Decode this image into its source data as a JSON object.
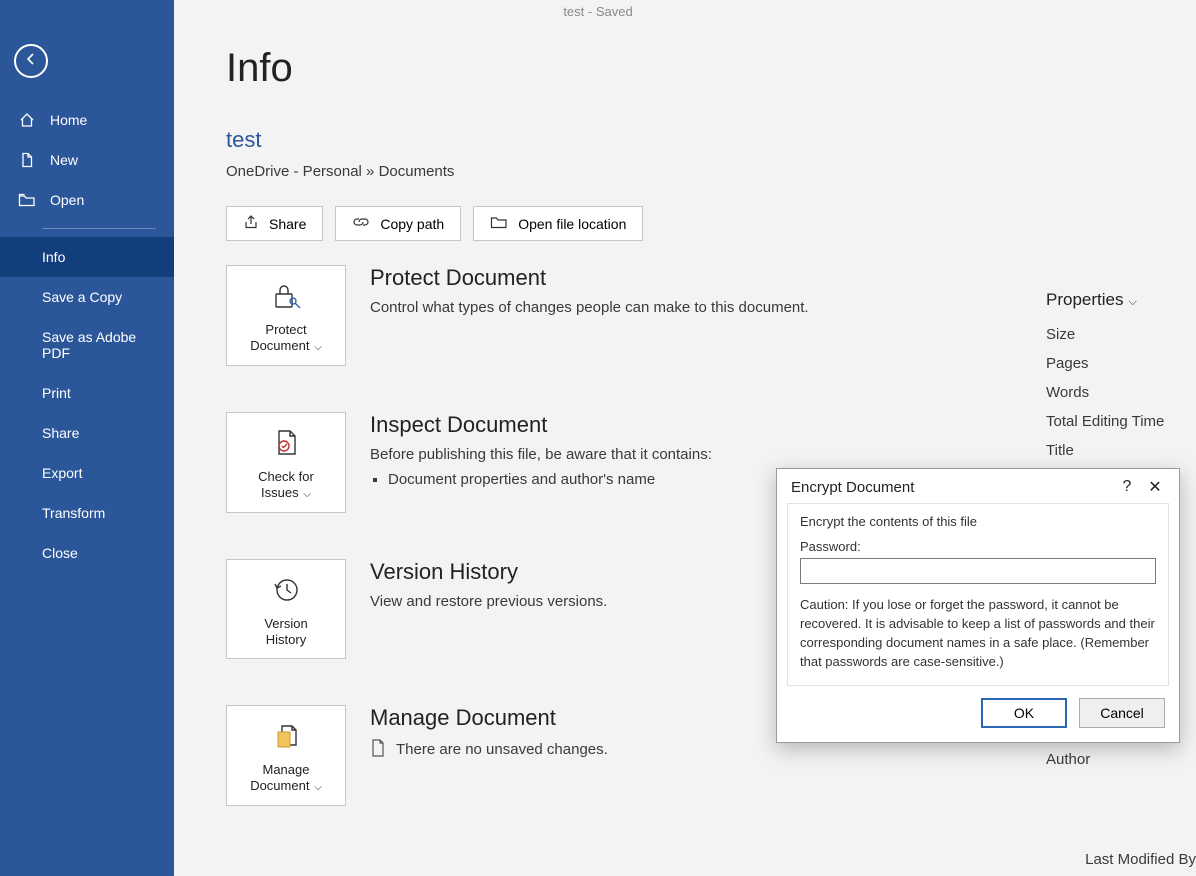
{
  "titlebar": {
    "text": "test - Saved"
  },
  "sidebar": {
    "back_aria": "Back",
    "items_top": [
      {
        "id": "home",
        "label": "Home"
      },
      {
        "id": "new",
        "label": "New"
      },
      {
        "id": "open",
        "label": "Open"
      }
    ],
    "items_bottom": [
      {
        "id": "info",
        "label": "Info",
        "active": true
      },
      {
        "id": "savecopy",
        "label": "Save a Copy"
      },
      {
        "id": "saveadobe",
        "label": "Save as Adobe PDF"
      },
      {
        "id": "print",
        "label": "Print"
      },
      {
        "id": "share",
        "label": "Share"
      },
      {
        "id": "export",
        "label": "Export"
      },
      {
        "id": "transform",
        "label": "Transform"
      },
      {
        "id": "close",
        "label": "Close"
      }
    ]
  },
  "main": {
    "page_title": "Info",
    "doc_name": "test",
    "breadcrumb": "OneDrive - Personal » Documents",
    "actions": {
      "share": "Share",
      "copy_path": "Copy path",
      "open_location": "Open file location"
    },
    "sections": {
      "protect": {
        "tile_line1": "Protect",
        "tile_line2": "Document",
        "title": "Protect Document",
        "desc": "Control what types of changes people can make to this document."
      },
      "inspect": {
        "tile_line1": "Check for",
        "tile_line2": "Issues",
        "title": "Inspect Document",
        "desc": "Before publishing this file, be aware that it contains:",
        "bullet1": "Document properties and author's name"
      },
      "version": {
        "tile_line1": "Version",
        "tile_line2": "History",
        "title": "Version History",
        "desc": "View and restore previous versions."
      },
      "manage": {
        "tile_line1": "Manage",
        "tile_line2": "Document",
        "title": "Manage Document",
        "desc": "There are no unsaved changes."
      }
    }
  },
  "properties": {
    "header": "Properties",
    "rows": [
      "Size",
      "Pages",
      "Words",
      "Total Editing Time",
      "Title"
    ],
    "author_label": "Author",
    "last_modified_by": "Last Modified By"
  },
  "dialog": {
    "title": "Encrypt Document",
    "group_title": "Encrypt the contents of this file",
    "password_label": "Password:",
    "password_value": "",
    "caution": "Caution: If you lose or forget the password, it cannot be recovered. It is advisable to keep a list of passwords and their corresponding document names in a safe place. (Remember that passwords are case-sensitive.)",
    "ok": "OK",
    "cancel": "Cancel"
  }
}
